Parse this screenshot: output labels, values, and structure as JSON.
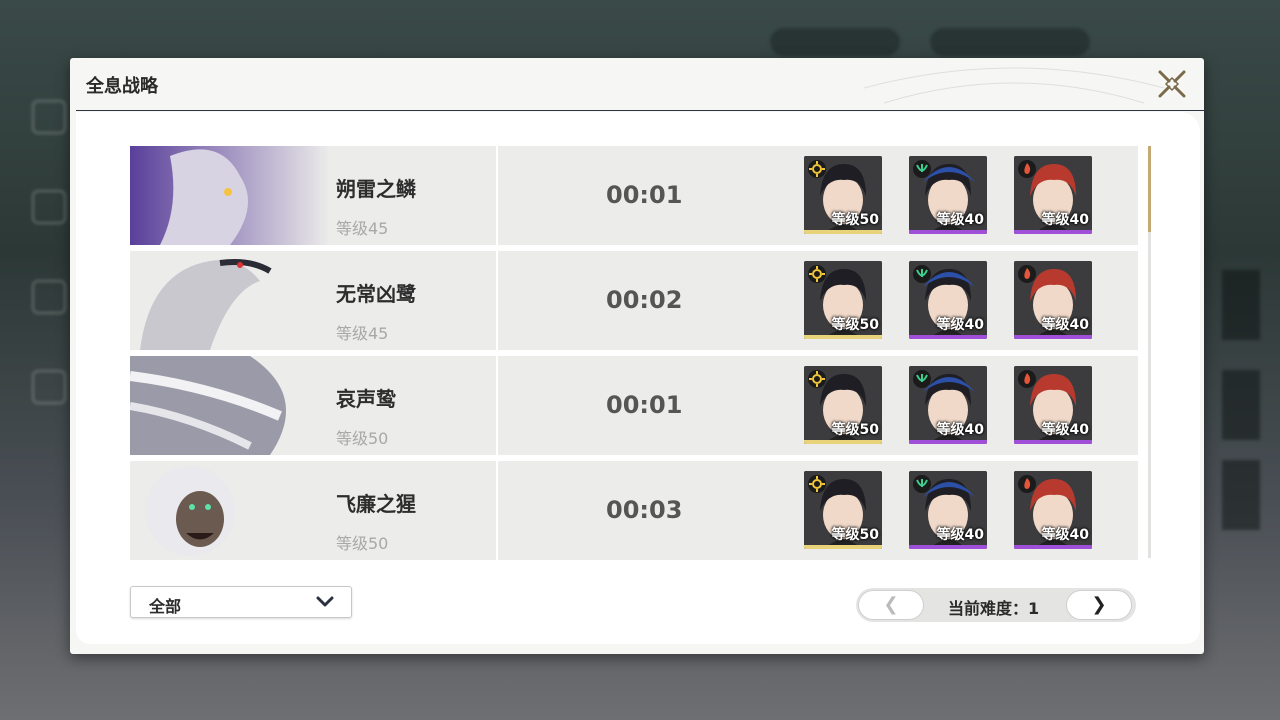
{
  "modal": {
    "title": "全息战略"
  },
  "bosses": [
    {
      "name": "朔雷之鳞",
      "level": "等级45",
      "time": "00:01",
      "team": [
        {
          "level": "等级50",
          "element": "spectro",
          "bar": "#e8d37a"
        },
        {
          "level": "等级40",
          "element": "aero",
          "bar": "#a04fd9"
        },
        {
          "level": "等级40",
          "element": "fusion",
          "bar": "#a04fd9"
        }
      ]
    },
    {
      "name": "无常凶鹭",
      "level": "等级45",
      "time": "00:02",
      "team": [
        {
          "level": "等级50",
          "element": "spectro",
          "bar": "#e8d37a"
        },
        {
          "level": "等级40",
          "element": "aero",
          "bar": "#a04fd9"
        },
        {
          "level": "等级40",
          "element": "fusion",
          "bar": "#a04fd9"
        }
      ]
    },
    {
      "name": "哀声鸷",
      "level": "等级50",
      "time": "00:01",
      "team": [
        {
          "level": "等级50",
          "element": "spectro",
          "bar": "#e8d37a"
        },
        {
          "level": "等级40",
          "element": "aero",
          "bar": "#a04fd9"
        },
        {
          "level": "等级40",
          "element": "fusion",
          "bar": "#a04fd9"
        }
      ]
    },
    {
      "name": "飞廉之猩",
      "level": "等级50",
      "time": "00:03",
      "team": [
        {
          "level": "等级50",
          "element": "spectro",
          "bar": "#e8d37a"
        },
        {
          "level": "等级40",
          "element": "aero",
          "bar": "#a04fd9"
        },
        {
          "level": "等级40",
          "element": "fusion",
          "bar": "#a04fd9"
        }
      ]
    }
  ],
  "filter": {
    "selected": "全部"
  },
  "pager": {
    "prev": "❮",
    "next": "❯",
    "label": "当前难度：1"
  },
  "colors": {
    "accent": "#c6a875",
    "element_spectro": "#f0c53a",
    "element_aero": "#3ecf8e",
    "element_fusion": "#e4553a"
  }
}
